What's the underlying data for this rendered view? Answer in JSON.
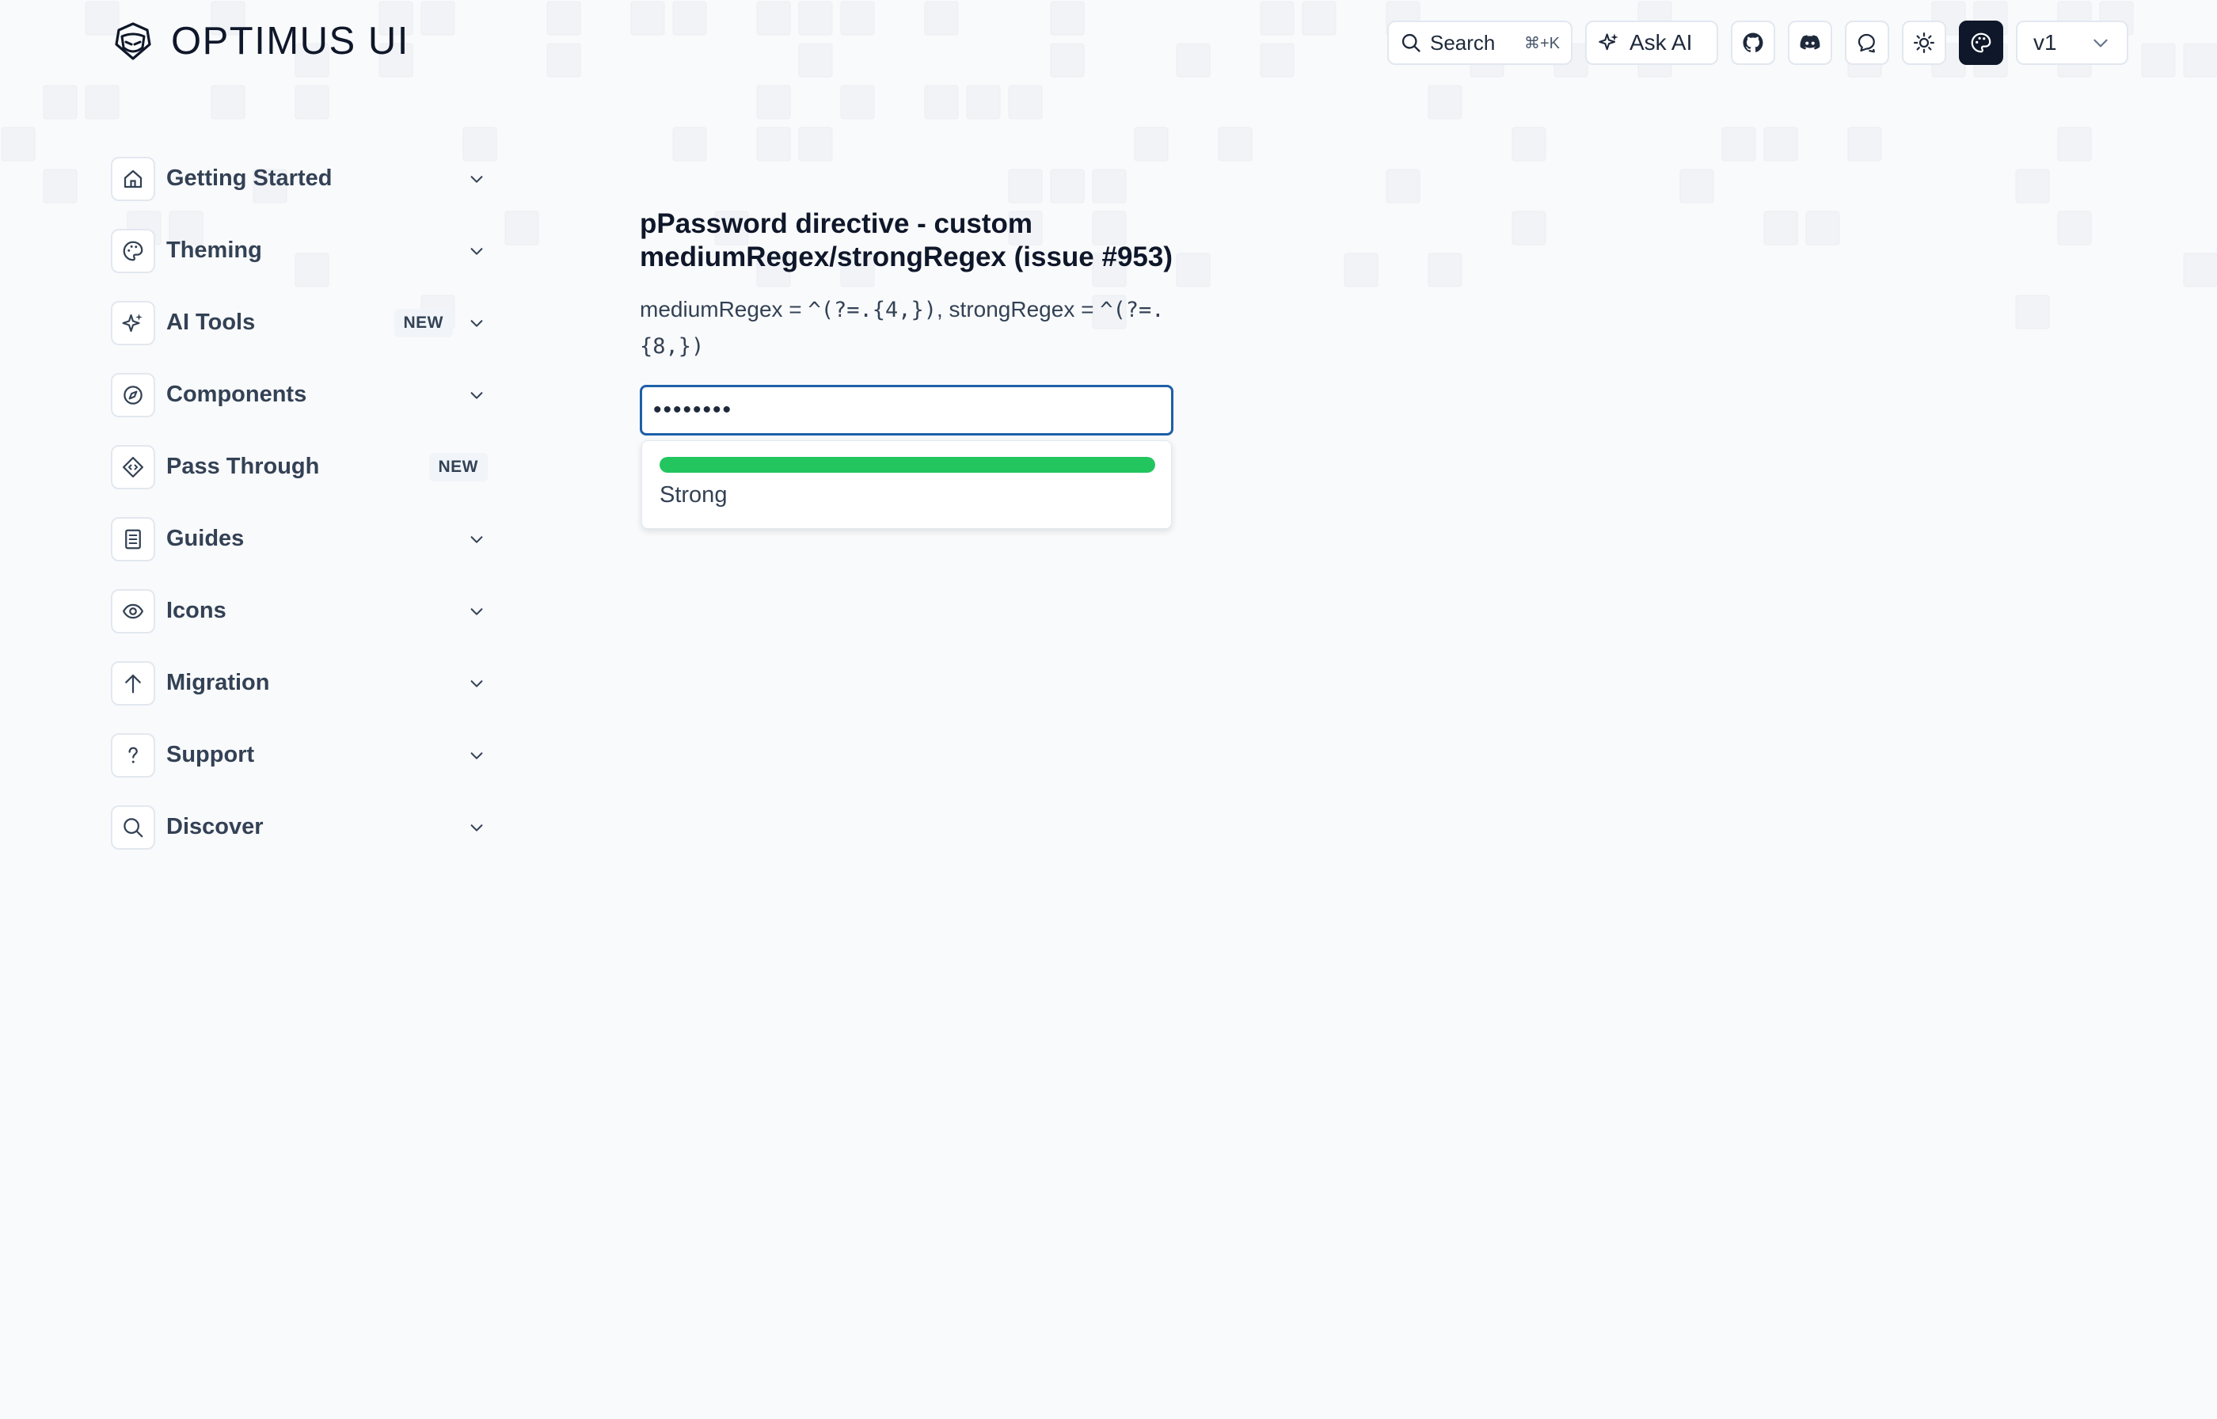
{
  "brand": {
    "name": "OPTIMUS UI"
  },
  "topbar": {
    "search_label": "Search",
    "search_shortcut": "⌘+K",
    "ask_ai_label": "Ask AI",
    "version": "v1"
  },
  "sidebar": {
    "items": [
      {
        "label": "Getting Started",
        "icon": "home-icon",
        "badge": ""
      },
      {
        "label": "Theming",
        "icon": "palette-icon",
        "badge": ""
      },
      {
        "label": "AI Tools",
        "icon": "sparkle-icon",
        "badge": "NEW"
      },
      {
        "label": "Components",
        "icon": "compass-icon",
        "badge": ""
      },
      {
        "label": "Pass Through",
        "icon": "diamond-code-icon",
        "badge": "NEW"
      },
      {
        "label": "Guides",
        "icon": "document-icon",
        "badge": ""
      },
      {
        "label": "Icons",
        "icon": "eye-icon",
        "badge": ""
      },
      {
        "label": "Migration",
        "icon": "arrow-up-icon",
        "badge": ""
      },
      {
        "label": "Support",
        "icon": "question-icon",
        "badge": ""
      },
      {
        "label": "Discover",
        "icon": "search-icon",
        "badge": ""
      }
    ]
  },
  "main": {
    "title": "pPassword directive - custom mediumRegex/strongRegex (issue #953)",
    "desc_prefix_medium": "mediumRegex = ",
    "medium_regex": "^(?=.{4,})",
    "desc_prefix_strong": ", strongRegex = ",
    "strong_regex": "^(?=.{8,})",
    "password_mask": "••••••••",
    "strength_label": "Strong",
    "strength_level": 1.0,
    "strength_color": "#22c55e"
  },
  "colors": {
    "accent": "#1d5fa8",
    "strong": "#22c55e"
  }
}
